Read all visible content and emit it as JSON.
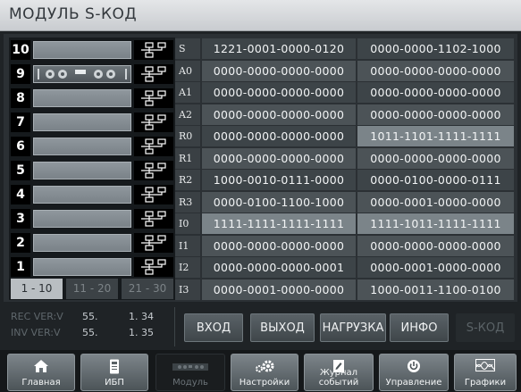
{
  "title": "МОДУЛЬ S-КОД",
  "slots": [
    {
      "num": "10",
      "filled": false
    },
    {
      "num": "9",
      "filled": true
    },
    {
      "num": "8",
      "filled": false
    },
    {
      "num": "7",
      "filled": false
    },
    {
      "num": "6",
      "filled": false
    },
    {
      "num": "5",
      "filled": false
    },
    {
      "num": "4",
      "filled": false
    },
    {
      "num": "3",
      "filled": false
    },
    {
      "num": "2",
      "filled": false
    },
    {
      "num": "1",
      "filled": false
    }
  ],
  "pages": [
    "1 - 10",
    "11 - 20",
    "21 - 30"
  ],
  "rows": [
    {
      "label": "S",
      "v1": "1221-0001-0000-0120",
      "v2": "0000-0000-1102-1000"
    },
    {
      "label": "A0",
      "v1": "0000-0000-0000-0000",
      "v2": "0000-0000-0000-0000"
    },
    {
      "label": "A1",
      "v1": "0000-0000-0000-0000",
      "v2": "0000-0000-0000-0000"
    },
    {
      "label": "A2",
      "v1": "0000-0000-0000-0000",
      "v2": "0000-0000-0000-0000"
    },
    {
      "label": "R0",
      "v1": "0000-0000-0000-0000",
      "v2": "1011-1101-1111-1111"
    },
    {
      "label": "R1",
      "v1": "0000-0000-0000-0000",
      "v2": "0000-0000-0000-0000"
    },
    {
      "label": "R2",
      "v1": "1000-0010-0111-0000",
      "v2": "0000-0100-0000-0111"
    },
    {
      "label": "R3",
      "v1": "0000-0100-1100-1000",
      "v2": "0000-0001-0000-0000"
    },
    {
      "label": "I0",
      "v1": "1111-1111-1111-1111",
      "v2": "1111-1011-1111-1111"
    },
    {
      "label": "I1",
      "v1": "0000-0000-0000-0000",
      "v2": "0000-0000-0000-0000"
    },
    {
      "label": "I2",
      "v1": "0000-0000-0000-0001",
      "v2": "0000-0001-0000-0000"
    },
    {
      "label": "I3",
      "v1": "0000-0001-0000-0000",
      "v2": "1000-0011-1100-0100"
    }
  ],
  "versions": {
    "rec_label": "REC VER:V",
    "rec_a": "55.",
    "rec_b": "1. 34",
    "inv_label": "INV VER:V",
    "inv_a": "55.",
    "inv_b": "1. 35"
  },
  "buttons": {
    "input": "ВХОД",
    "output": "ВЫХОД",
    "load": "НАГРУЗКА",
    "info": "ИНФО",
    "scode": "S-КОД"
  },
  "nav": {
    "home": "Главная",
    "ups": "ИБП",
    "module": "Модуль",
    "settings": "Настройки",
    "events": "Журнал событий",
    "control": "Управление",
    "graphs": "Графики"
  },
  "icons": {
    "home": "home-icon",
    "ups": "ups-cabinet-icon",
    "module": "module-icon",
    "settings": "gear-icon",
    "events": "event-log-icon",
    "control": "power-icon",
    "graphs": "graph-icon"
  }
}
